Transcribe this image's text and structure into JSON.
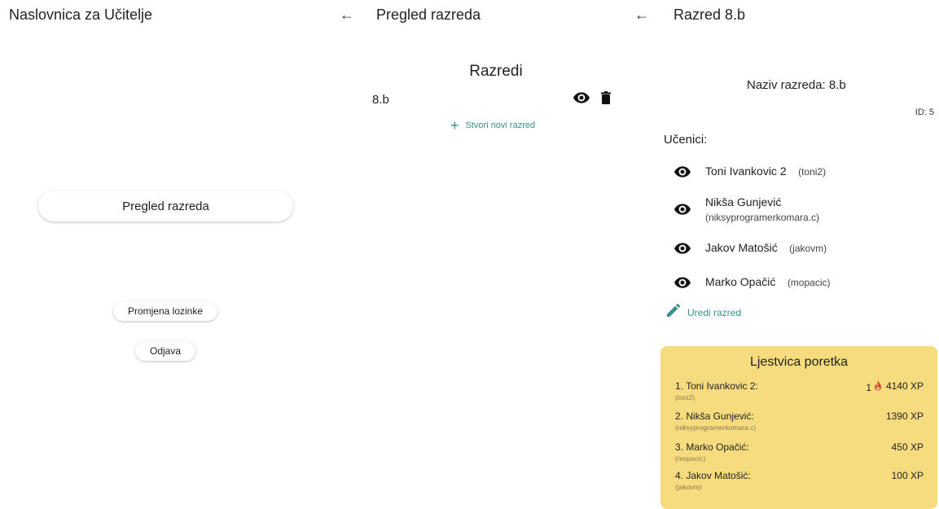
{
  "panel1": {
    "title": "Naslovnica za Učitelje",
    "overview_button": "Pregled razreda",
    "change_password_button": "Promjena lozinke",
    "logout_button": "Odjava"
  },
  "panel2": {
    "back_arrow": "←",
    "title": "Pregled razreda",
    "heading": "Razredi",
    "classes": [
      {
        "name": "8.b"
      }
    ],
    "create_button": "Stvori novi razred",
    "icons": [
      "eye-icon",
      "trash-icon",
      "plus-icon"
    ],
    "accent_color": "#3a8f88"
  },
  "panel3": {
    "back_arrow": "←",
    "title": "Razred 8.b",
    "class_name_label": "Naziv razreda: 8.b",
    "id_label": "ID: 5",
    "students_label": "Učenici:",
    "students": [
      {
        "name": "Toni Ivankovic 2",
        "username": "(toni2)"
      },
      {
        "name": "Nikša Gunjević",
        "username": "(niksyprogramerkomara.c)"
      },
      {
        "name": "Jakov Matošić",
        "username": "(jakovm)"
      },
      {
        "name": "Marko Opačić",
        "username": "(mopacic)"
      }
    ],
    "edit_button": "Uredi razred",
    "leaderboard": {
      "title": "Ljestvica poretka",
      "background": "#f6dc7e",
      "rows": [
        {
          "name": "1. Toni Ivankovic 2:",
          "username": "(toni2)",
          "streak": "1",
          "xp": "4140 XP"
        },
        {
          "name": "2. Nikša Gunjević:",
          "username": "(niksyprogramerkomara.c)",
          "xp": "1390 XP"
        },
        {
          "name": "3. Marko Opačić:",
          "username": "(mopacic)",
          "xp": "450 XP"
        },
        {
          "name": "4. Jakov Matošić:",
          "username": "(jakovm)",
          "xp": "100 XP"
        }
      ]
    }
  }
}
